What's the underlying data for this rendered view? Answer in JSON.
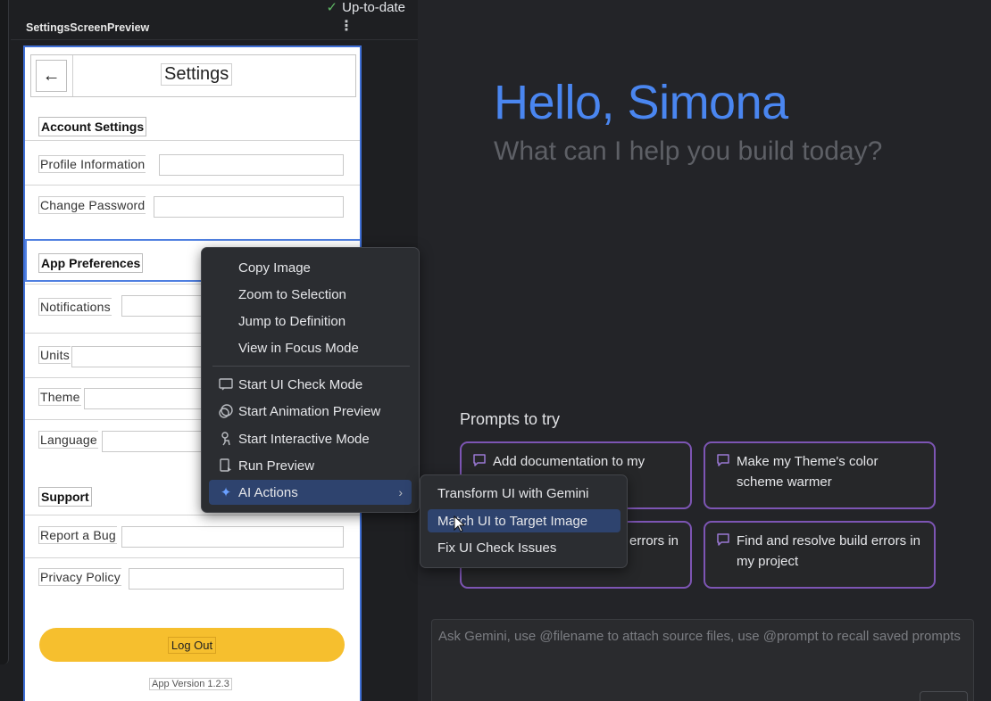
{
  "status": {
    "text": "Up-to-date"
  },
  "preview": {
    "label": "SettingsScreenPreview",
    "more": "⋮",
    "app": {
      "title": "Settings",
      "back_icon": "←",
      "sections": [
        {
          "title": "Account Settings",
          "items": [
            "Profile Information",
            "Change Password"
          ]
        },
        {
          "title": "App Preferences",
          "items": [
            "Notifications",
            "Units",
            "Theme",
            "Language"
          ]
        },
        {
          "title": "Support",
          "items": [
            "Report a Bug",
            "Privacy Policy"
          ]
        }
      ],
      "logout_label": "Log Out",
      "version": "App Version 1.2.3",
      "accent": "#f6bf2e"
    }
  },
  "context_menu": {
    "items": [
      {
        "label": "Copy Image"
      },
      {
        "label": "Zoom to Selection"
      },
      {
        "label": "Jump to Definition"
      },
      {
        "label": "View in Focus Mode"
      },
      {
        "label": "Start UI Check Mode",
        "icon": "ui-check-icon"
      },
      {
        "label": "Start Animation Preview",
        "icon": "animation-icon"
      },
      {
        "label": "Start Interactive Mode",
        "icon": "interactive-icon"
      },
      {
        "label": "Run Preview",
        "icon": "run-preview-icon"
      },
      {
        "label": "AI Actions",
        "icon": "sparkle-icon"
      }
    ],
    "submenu": [
      {
        "label": "Transform UI with Gemini"
      },
      {
        "label": "Match UI to Target Image"
      },
      {
        "label": "Fix UI Check Issues"
      }
    ]
  },
  "gemini": {
    "greeting": "Hello, Simona",
    "subtitle": "What can I help you build today?",
    "prompts_title": "Prompts to try",
    "prompts": [
      "Add documentation to my",
      "Make my Theme's color scheme warmer",
      "errors in",
      "Find and resolve build errors in my project"
    ],
    "input_placeholder": "Ask Gemini, use @filename to attach source files, use @prompt to recall saved prompts",
    "greeting_color": "#4a86f0",
    "card_border_color": "#7d55b4"
  }
}
